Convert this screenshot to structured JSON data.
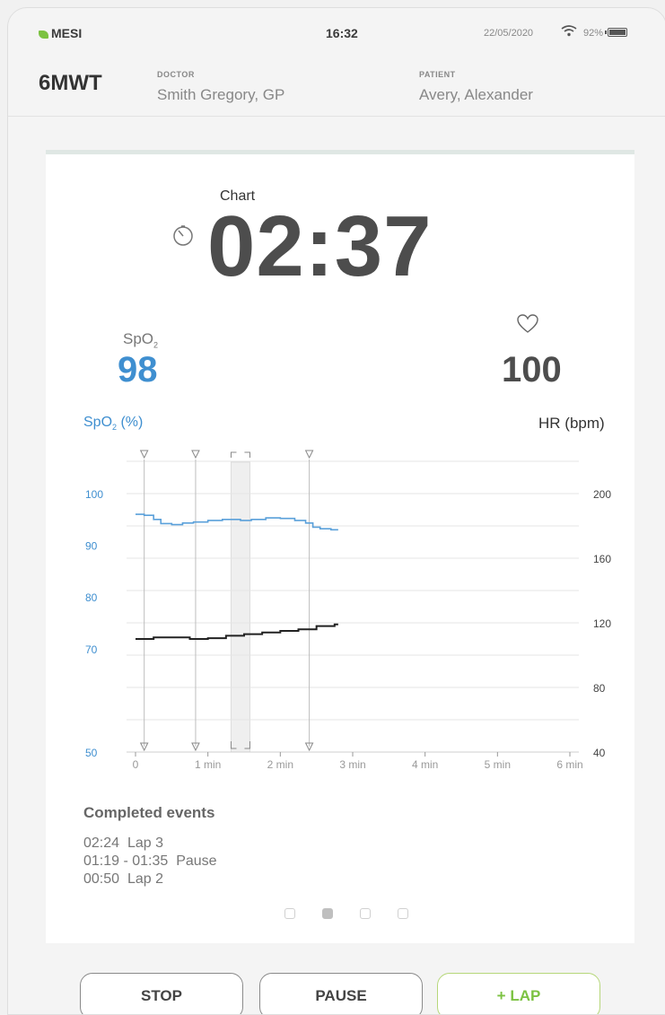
{
  "status_bar": {
    "brand": "MESI",
    "time": "16:32",
    "date": "22/05/2020",
    "battery": "92%",
    "icons": [
      "leaf-logo-icon",
      "wifi-icon",
      "battery-icon"
    ]
  },
  "header": {
    "title": "6MWT",
    "doctor_label": "DOCTOR",
    "doctor": "Smith Gregory, GP",
    "patient_label": "PATIENT",
    "patient": "Avery, Alexander"
  },
  "card": {
    "chart_label": "Chart",
    "timer": "02:37",
    "spo2_label": "SpO",
    "spo2_sub": "2",
    "spo2_value": "98",
    "hr_value": "100",
    "icons": [
      "stopwatch-icon",
      "heart-icon"
    ]
  },
  "chart_data": {
    "type": "line",
    "left_axis_title": "SpO",
    "left_axis_sub": "2",
    "left_axis_unit": " (%)",
    "right_axis_title": "HR (bpm)",
    "x_ticks": [
      "0",
      "1 min",
      "2 min",
      "3 min",
      "4 min",
      "5 min",
      "6 min"
    ],
    "xlim": [
      0,
      6
    ],
    "y_left_ticks": [
      100,
      90,
      80,
      70,
      50
    ],
    "y_left_lim": [
      50,
      100
    ],
    "y_right_ticks": [
      200,
      160,
      120,
      80,
      40
    ],
    "y_right_lim": [
      40,
      200
    ],
    "grid": true,
    "colors": {
      "spo2": "#5aa0da",
      "hr": "#222222",
      "left_axis": "#3f8fd0",
      "shading": "#efefef"
    },
    "lap_markers_min": [
      0.12,
      0.83,
      2.4
    ],
    "pause_window_min": [
      1.32,
      1.58
    ],
    "series": [
      {
        "axis": "left",
        "color": "#5aa0da",
        "x": [
          0,
          0.12,
          0.25,
          0.35,
          0.5,
          0.65,
          0.8,
          1.0,
          1.2,
          1.45,
          1.6,
          1.8,
          2.0,
          2.2,
          2.35,
          2.45,
          2.55,
          2.7,
          2.8
        ],
        "y": [
          96,
          95.8,
          95,
          94.2,
          94,
          94.3,
          94.5,
          94.8,
          95,
          94.8,
          95,
          95.3,
          95.2,
          94.8,
          94.3,
          93.5,
          93.2,
          93,
          93
        ]
      },
      {
        "axis": "right",
        "color": "#222222",
        "x": [
          0,
          0.25,
          0.5,
          0.75,
          1.0,
          1.25,
          1.5,
          1.75,
          2.0,
          2.25,
          2.5,
          2.75,
          2.8
        ],
        "y": [
          110,
          111,
          111,
          110,
          110.5,
          112,
          113,
          114,
          115,
          116,
          118,
          119,
          119
        ]
      }
    ]
  },
  "events": {
    "title": "Completed events",
    "items": [
      {
        "time": "02:24",
        "label": "Lap 3"
      },
      {
        "time": "01:19 - 01:35",
        "label": "Pause"
      },
      {
        "time": "00:50",
        "label": "Lap 2"
      }
    ]
  },
  "pager": {
    "count": 4,
    "active": 1
  },
  "buttons": {
    "stop": "STOP",
    "pause": "PAUSE",
    "lap": "+ LAP"
  }
}
